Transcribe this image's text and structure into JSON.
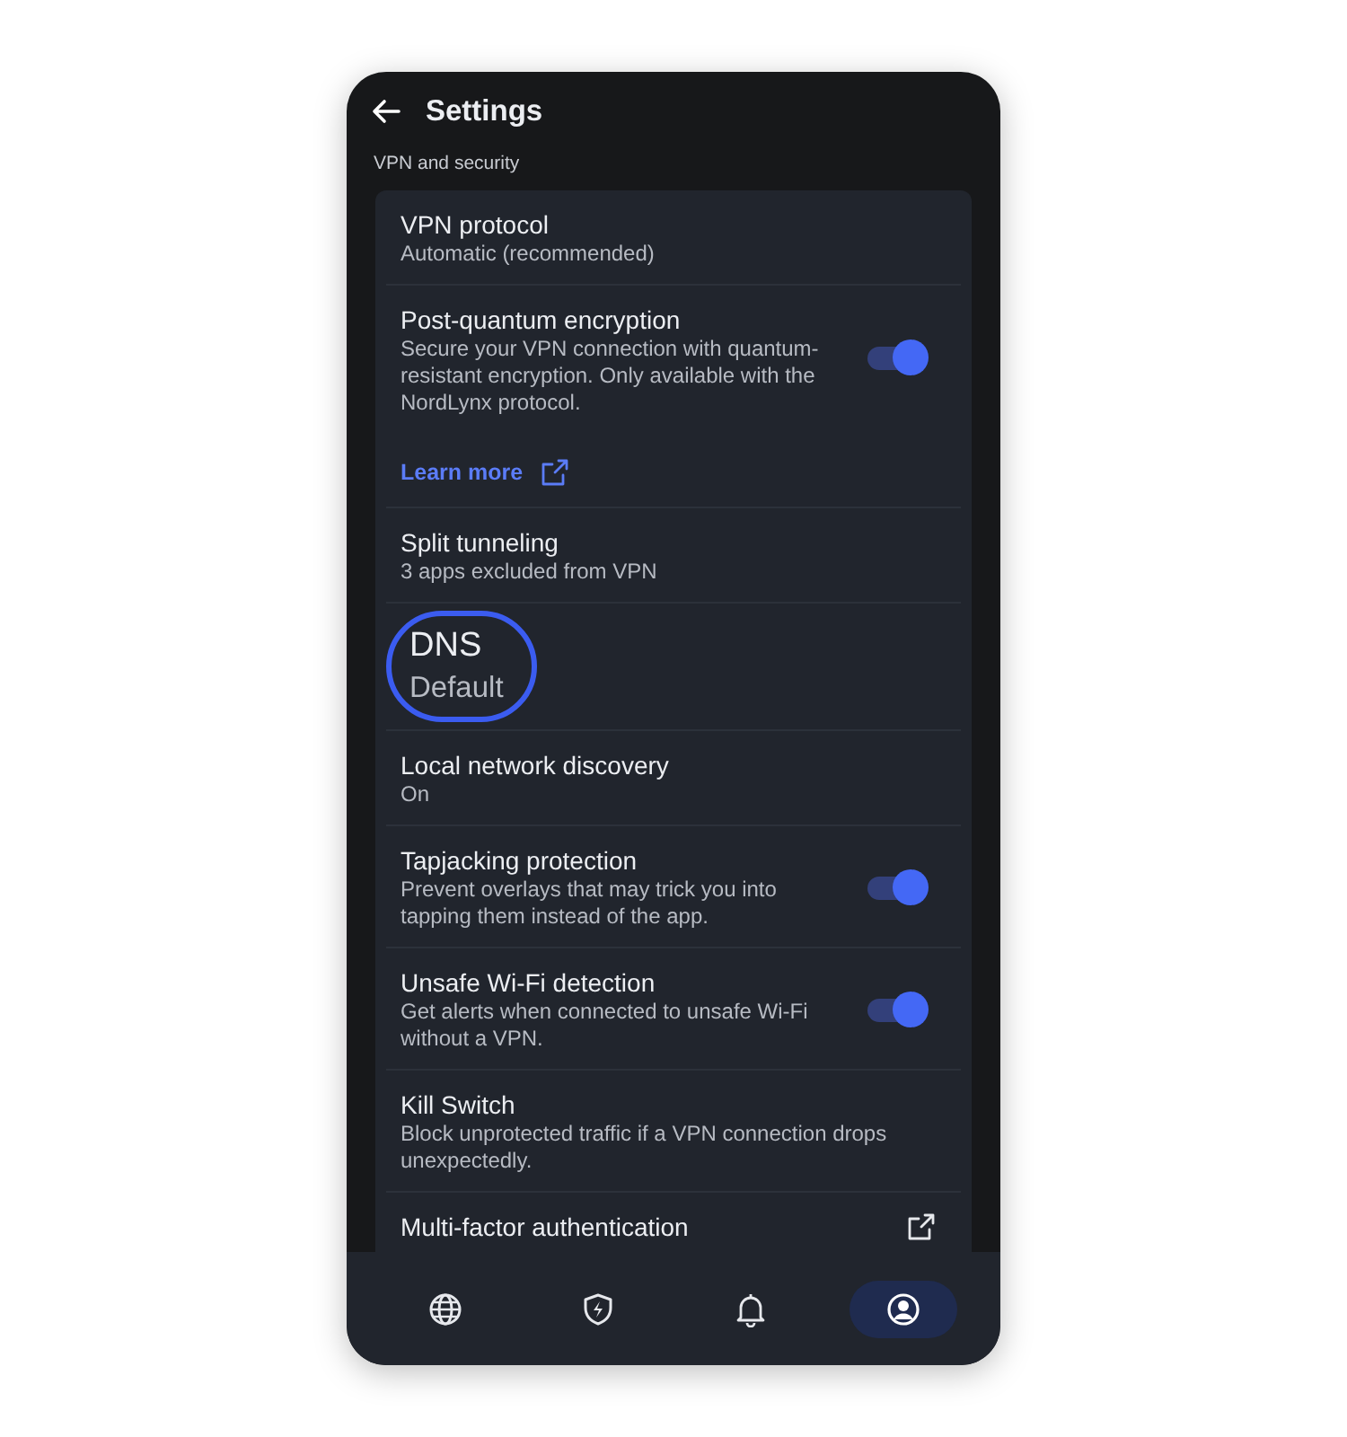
{
  "header": {
    "title": "Settings"
  },
  "section_label": "VPN and security",
  "items": [
    {
      "kind": "nav",
      "title": "VPN protocol",
      "subtitle": "Automatic (recommended)"
    },
    {
      "kind": "toggle",
      "title": "Post-quantum encryption",
      "subtitle": "Secure your VPN connection with quantum-resistant encryption. Only available with the NordLynx protocol.",
      "on": true,
      "link": "Learn more"
    },
    {
      "kind": "nav",
      "title": "Split tunneling",
      "subtitle": "3 apps excluded from VPN"
    },
    {
      "kind": "nav",
      "title": "DNS",
      "subtitle": "Default",
      "highlighted": true
    },
    {
      "kind": "nav",
      "title": "Local network discovery",
      "subtitle": "On"
    },
    {
      "kind": "toggle",
      "title": "Tapjacking protection",
      "subtitle": "Prevent overlays that may trick you into tapping them instead of the app.",
      "on": true
    },
    {
      "kind": "toggle",
      "title": "Unsafe Wi-Fi detection",
      "subtitle": "Get alerts when connected to unsafe Wi-Fi without a VPN.",
      "on": true
    },
    {
      "kind": "nav",
      "title": "Kill Switch",
      "subtitle": "Block unprotected traffic if a VPN connection drops unexpectedly."
    },
    {
      "kind": "external",
      "title": "Multi-factor authentication"
    }
  ],
  "bottom_nav": [
    {
      "kind": "globe",
      "selected": false
    },
    {
      "kind": "shield",
      "selected": false
    },
    {
      "kind": "bell",
      "selected": false
    },
    {
      "kind": "profile",
      "selected": true
    }
  ]
}
